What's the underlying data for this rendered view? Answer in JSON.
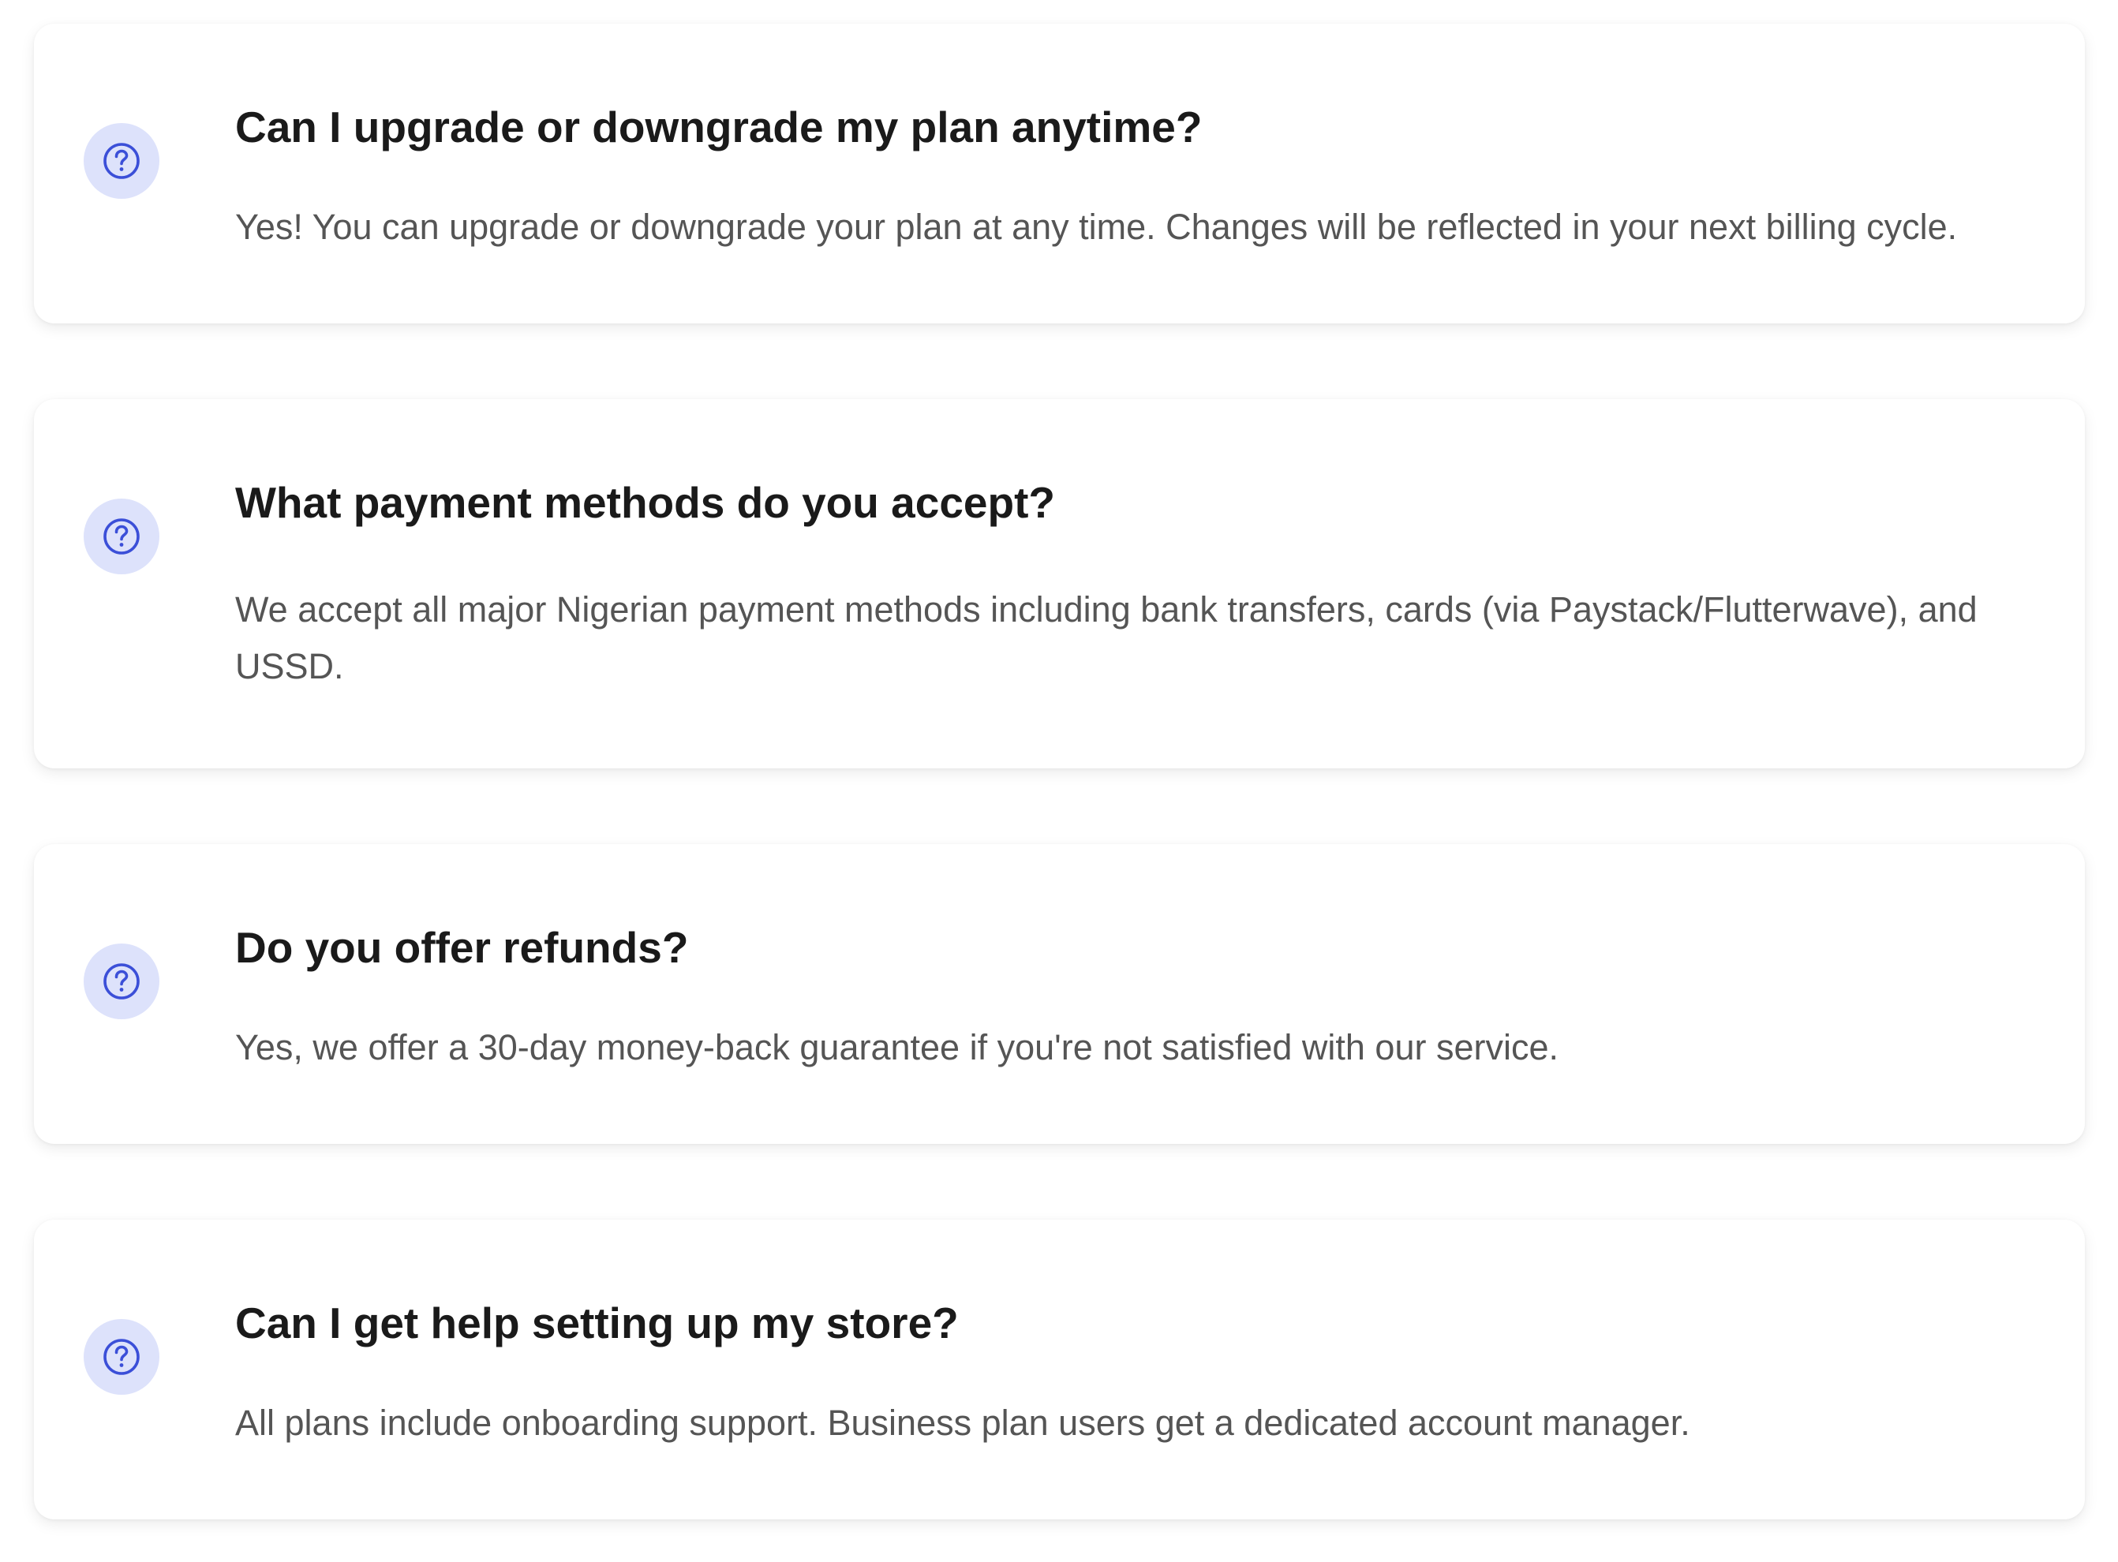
{
  "theme": {
    "card_background": "#ffffff",
    "icon_background": "#dde2fb",
    "icon_stroke": "#3b4fd8",
    "question_color": "#1a1a1a",
    "answer_color": "#555555"
  },
  "faq": {
    "items": [
      {
        "icon": "question-circle-icon",
        "question": "Can I upgrade or downgrade my plan anytime?",
        "answer": "Yes! You can upgrade or downgrade your plan at any time. Changes will be reflected in your next billing cycle."
      },
      {
        "icon": "question-circle-icon",
        "question": "What payment methods do you accept?",
        "answer": "We accept all major Nigerian payment methods including bank transfers, cards (via Paystack/Flutterwave), and USSD."
      },
      {
        "icon": "question-circle-icon",
        "question": "Do you offer refunds?",
        "answer": "Yes, we offer a 30-day money-back guarantee if you're not satisfied with our service."
      },
      {
        "icon": "question-circle-icon",
        "question": "Can I get help setting up my store?",
        "answer": "All plans include onboarding support. Business plan users get a dedicated account manager."
      }
    ]
  }
}
